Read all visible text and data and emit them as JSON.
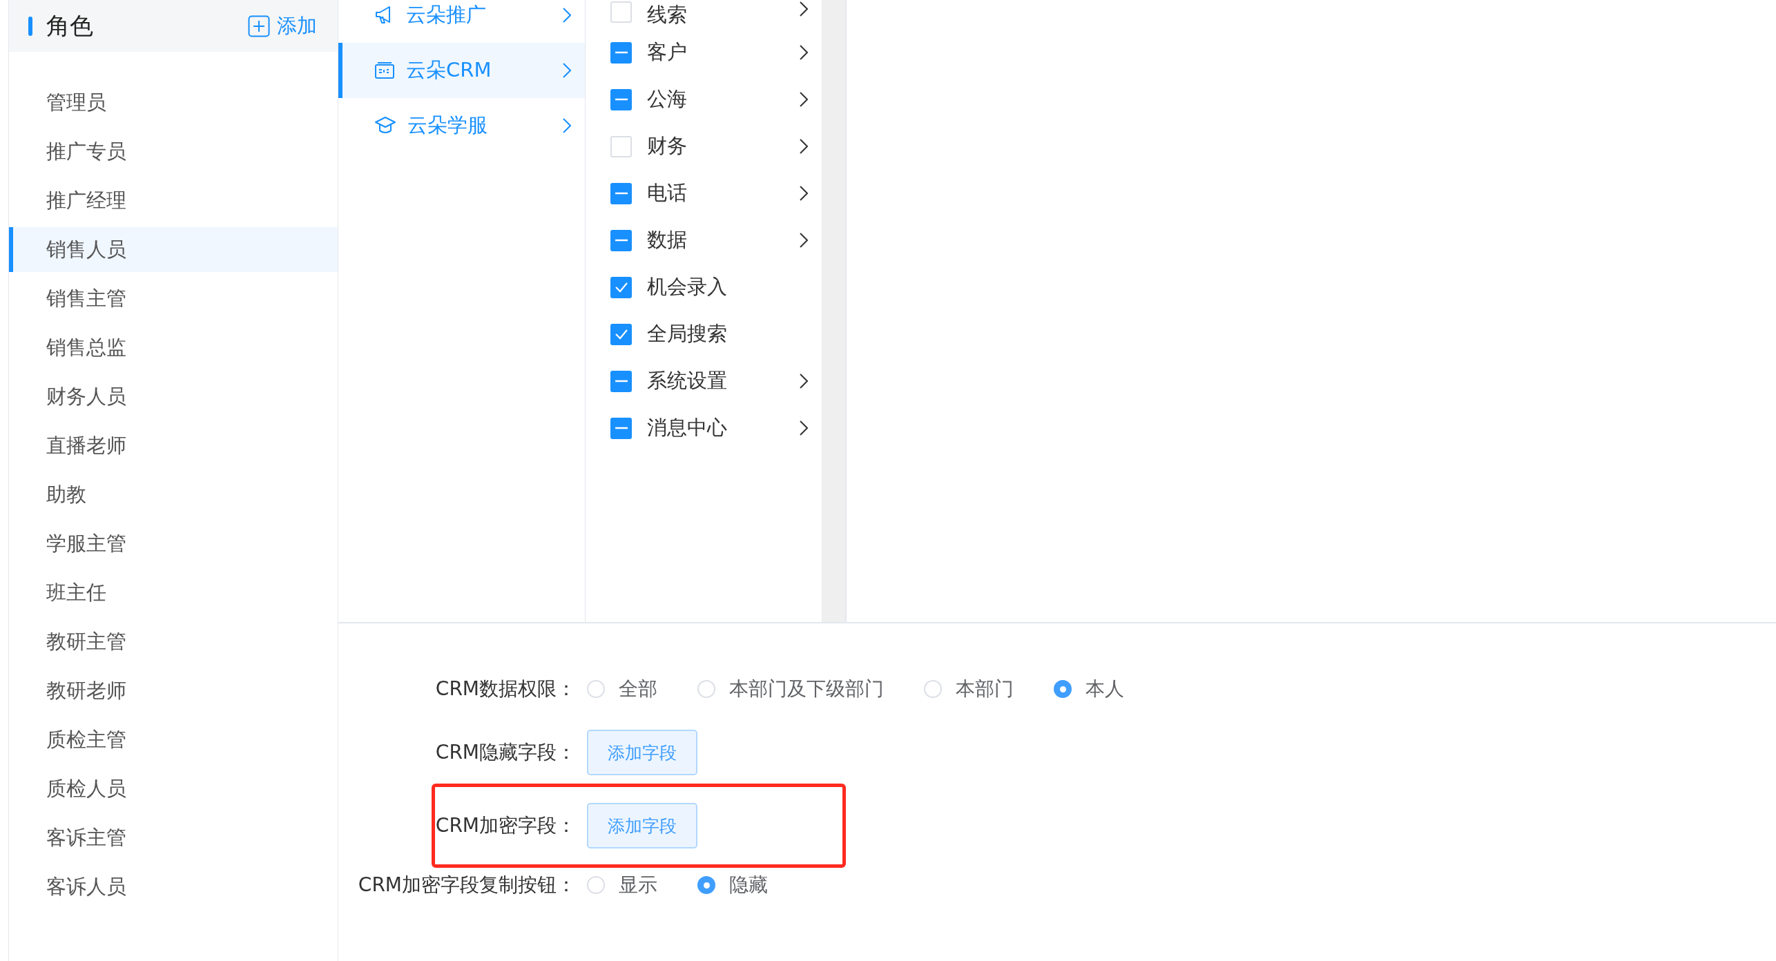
{
  "sidebar": {
    "title": "角色",
    "add_label": "添加",
    "items": [
      {
        "label": "管理员",
        "selected": false
      },
      {
        "label": "推广专员",
        "selected": false
      },
      {
        "label": "推广经理",
        "selected": false
      },
      {
        "label": "销售人员",
        "selected": true
      },
      {
        "label": "销售主管",
        "selected": false
      },
      {
        "label": "销售总监",
        "selected": false
      },
      {
        "label": "财务人员",
        "selected": false
      },
      {
        "label": "直播老师",
        "selected": false
      },
      {
        "label": "助教",
        "selected": false
      },
      {
        "label": "学服主管",
        "selected": false
      },
      {
        "label": "班主任",
        "selected": false
      },
      {
        "label": "教研主管",
        "selected": false
      },
      {
        "label": "教研老师",
        "selected": false
      },
      {
        "label": "质检主管",
        "selected": false
      },
      {
        "label": "质检人员",
        "selected": false
      },
      {
        "label": "客诉主管",
        "selected": false
      },
      {
        "label": "客诉人员",
        "selected": false
      }
    ]
  },
  "apps": [
    {
      "kind": "megaphone",
      "label": "云朵推广",
      "selected": false
    },
    {
      "kind": "crm",
      "label": "云朵CRM",
      "selected": true
    },
    {
      "kind": "cap",
      "label": "云朵学服",
      "selected": false
    }
  ],
  "permissions": [
    {
      "label": "线索",
      "checked": false,
      "indeterminate": false,
      "has_children": true
    },
    {
      "label": "客户",
      "checked": false,
      "indeterminate": true,
      "has_children": true
    },
    {
      "label": "公海",
      "checked": false,
      "indeterminate": true,
      "has_children": true
    },
    {
      "label": "财务",
      "checked": false,
      "indeterminate": false,
      "has_children": true
    },
    {
      "label": "电话",
      "checked": false,
      "indeterminate": true,
      "has_children": true
    },
    {
      "label": "数据",
      "checked": false,
      "indeterminate": true,
      "has_children": true
    },
    {
      "label": "机会录入",
      "checked": true,
      "indeterminate": false,
      "has_children": false
    },
    {
      "label": "全局搜索",
      "checked": true,
      "indeterminate": false,
      "has_children": false
    },
    {
      "label": "系统设置",
      "checked": false,
      "indeterminate": true,
      "has_children": true
    },
    {
      "label": "消息中心",
      "checked": false,
      "indeterminate": true,
      "has_children": true
    }
  ],
  "form": [
    {
      "kind": "radio",
      "label": "CRM数据权限：",
      "highlighted": false,
      "options": [
        {
          "label": "全部",
          "selected": false
        },
        {
          "label": "本部门及下级部门",
          "selected": false
        },
        {
          "label": "本部门",
          "selected": false
        },
        {
          "label": "本人",
          "selected": true
        }
      ]
    },
    {
      "kind": "button",
      "label": "CRM隐藏字段：",
      "highlighted": false,
      "button": "添加字段"
    },
    {
      "kind": "button",
      "label": "CRM加密字段：",
      "highlighted": true,
      "button": "添加字段"
    },
    {
      "kind": "radio",
      "label": "CRM加密字段复制按钮：",
      "highlighted": false,
      "options": [
        {
          "label": "显示",
          "selected": false
        },
        {
          "label": "隐藏",
          "selected": true
        }
      ]
    }
  ]
}
